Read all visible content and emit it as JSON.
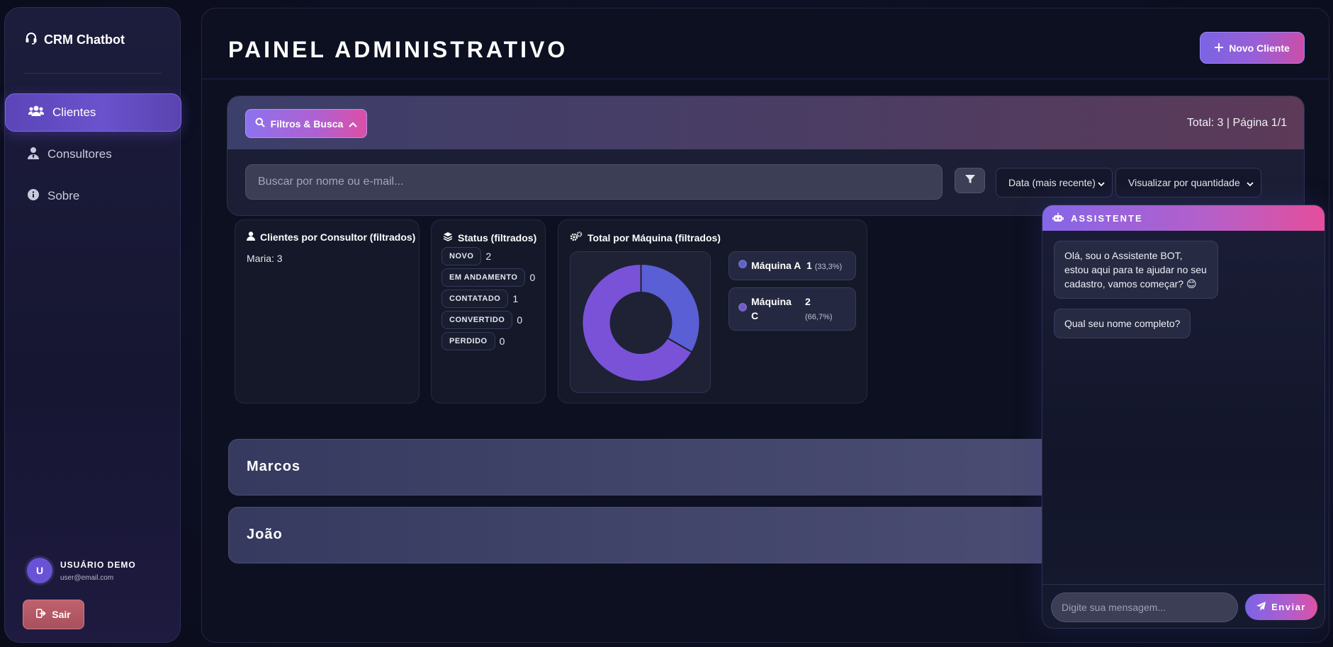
{
  "brand": {
    "name": "CRM Chatbot",
    "icon": "headset-icon"
  },
  "sidebar": {
    "items": [
      {
        "label": "Clientes",
        "icon": "users-icon",
        "active": true
      },
      {
        "label": "Consultores",
        "icon": "user-tie-icon",
        "active": false
      },
      {
        "label": "Sobre",
        "icon": "info-icon",
        "active": false
      }
    ],
    "user": {
      "initial": "U",
      "name": "USUÁRIO DEMO",
      "email": "user@email.com"
    },
    "logout_label": "Sair"
  },
  "header": {
    "title": "PAINEL ADMINISTRATIVO",
    "new_client_label": "Novo Cliente"
  },
  "filters": {
    "toggle_label": "Filtros & Busca",
    "total_text": "Total: 3 | Página 1/1",
    "search_placeholder": "Buscar por nome ou e-mail...",
    "sort_select": "Data (mais recente)",
    "view_select": "Visualizar por quantidade"
  },
  "cards": {
    "consultor": {
      "title": "Clientes por Consultor (filtrados)",
      "lines": [
        "Maria: 3"
      ]
    },
    "status": {
      "title": "Status (filtrados)",
      "rows": [
        {
          "label": "NOVO",
          "count": "2"
        },
        {
          "label": "EM ANDAMENTO",
          "count": "0"
        },
        {
          "label": "CONTATADO",
          "count": "1"
        },
        {
          "label": "CONVERTIDO",
          "count": "0"
        },
        {
          "label": "PERDIDO",
          "count": "0"
        }
      ]
    },
    "maquina": {
      "title": "Total por Máquina (filtrados)",
      "legend": [
        {
          "name": "Máquina A",
          "value": "1",
          "pct": "(33,3%)"
        },
        {
          "name": "Máquina C",
          "value": "2",
          "pct": "(66,7%)"
        }
      ]
    }
  },
  "chart_data": {
    "type": "pie",
    "title": "Total por Máquina (filtrados)",
    "categories": [
      "Máquina A",
      "Máquina C"
    ],
    "values": [
      1,
      2
    ],
    "colors": [
      "#5a5fd6",
      "#7a52d8"
    ]
  },
  "groups": [
    {
      "name": "Marcos"
    },
    {
      "name": "João"
    }
  ],
  "chat": {
    "title": "ASSISTENTE",
    "messages": [
      "Olá, sou o Assistente BOT, estou aqui para te ajudar no seu cadastro, vamos começar? 😊",
      "Qual seu nome completo?"
    ],
    "input_placeholder": "Digite sua mensagem...",
    "send_label": "Enviar"
  },
  "colors": {
    "accent": "#6a52cc",
    "pink": "#de50a4",
    "background": "#0d1020"
  }
}
